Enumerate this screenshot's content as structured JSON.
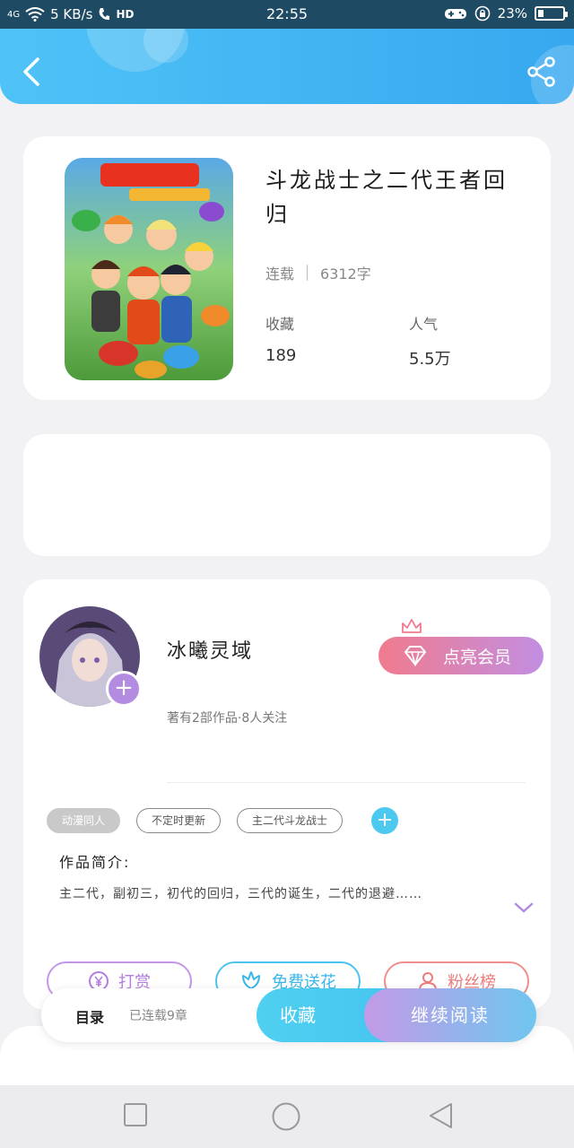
{
  "status_bar": {
    "network": "4G",
    "speed": "5 KB/s",
    "hd": "HD",
    "time": "22:55",
    "battery": "23%",
    "battery_level": 0.23
  },
  "book": {
    "title": "斗龙战士之二代王者回归",
    "status": "连载",
    "word_count": "6312字",
    "favorites_label": "收藏",
    "favorites_value": "189",
    "popularity_label": "人气",
    "popularity_value": "5.5万"
  },
  "author": {
    "name": "冰曦灵域",
    "summary": "著有2部作品·8人关注",
    "vip_label": "点亮会员",
    "tags": [
      "动漫同人",
      "不定时更新",
      "主二代斗龙战士"
    ],
    "intro_label": "作品简介:",
    "intro_text": "主二代，副初三，初代的回归，三代的诞生，二代的退避……"
  },
  "actions": {
    "reward": "打赏",
    "flower": "免费送花",
    "fans": "粉丝榜"
  },
  "bottom_bar": {
    "toc": "目录",
    "toc_status": "已连载9章",
    "collect": "收藏",
    "read": "继续阅读"
  },
  "icons": {
    "back": "chevron-left-icon",
    "share": "share-icon",
    "vip": "diamond-icon",
    "reward": "yen-coin-icon",
    "flower": "flower-icon",
    "fans": "user-icon",
    "expand": "chevron-down-icon"
  },
  "colors": {
    "header": "#4fc3f7",
    "accent_blue": "#4dc9f0",
    "accent_purple": "#b38be0",
    "vip_start": "#f07b8e",
    "vip_end": "#c28ee2"
  }
}
